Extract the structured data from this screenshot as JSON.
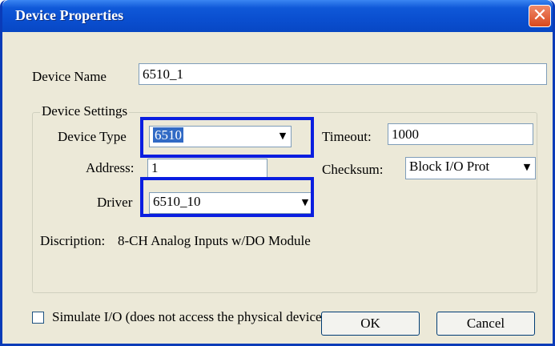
{
  "window": {
    "title": "Device Properties",
    "close_glyph": "✕"
  },
  "device_name": {
    "label": "Device Name",
    "value": "6510_1"
  },
  "device_settings": {
    "group_label": "Device Settings",
    "device_type": {
      "label": "Device Type",
      "value": "6510"
    },
    "timeout": {
      "label": "Timeout:",
      "value": "1000"
    },
    "address": {
      "label": "Address:",
      "value": "1"
    },
    "checksum": {
      "label": "Checksum:",
      "value": "Block I/O Prot"
    },
    "driver": {
      "label": "Driver",
      "value": "6510_10"
    },
    "description": {
      "label": "Discription:",
      "value": "8-CH Analog Inputs w/DO Module"
    }
  },
  "simulate": {
    "label": "Simulate I/O (does not access the physical device)",
    "checked": false
  },
  "buttons": {
    "ok": "OK",
    "cancel": "Cancel"
  },
  "icons": {
    "dropdown": "▼",
    "close": "close-icon"
  },
  "colors": {
    "title_bar": "#0a4fd0",
    "highlight_box": "#0a1ee0",
    "selection": "#316ac5",
    "dialog_bg": "#ece9d8"
  }
}
